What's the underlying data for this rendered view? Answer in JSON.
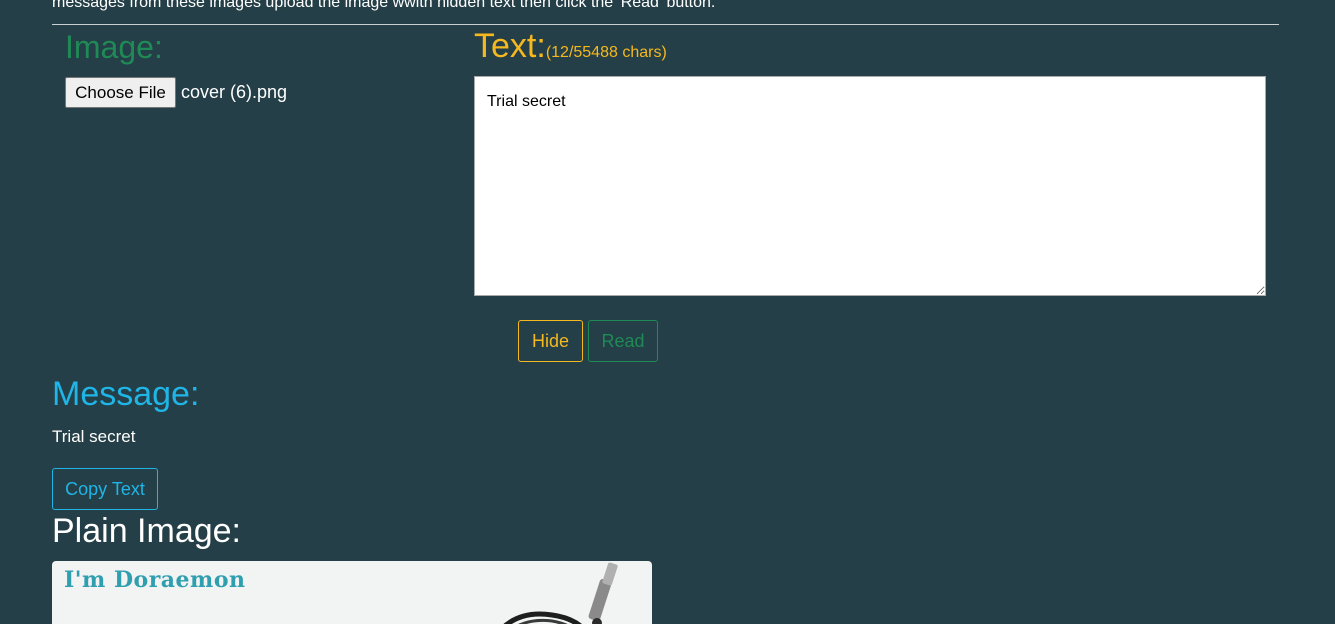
{
  "intro": {
    "text": "messages from these images upload the image wwith hidden text then click the 'Read' button."
  },
  "image_panel": {
    "heading": "Image:",
    "choose_file_label": "Choose File",
    "file_name": "cover (6).png"
  },
  "text_panel": {
    "heading": "Text:",
    "char_count": "(12/55488 chars)",
    "value": "Trial secret"
  },
  "actions": {
    "hide_label": "Hide",
    "read_label": "Read"
  },
  "message": {
    "heading": "Message:",
    "text": "Trial secret",
    "copy_label": "Copy Text"
  },
  "plain_image": {
    "heading": "Plain Image:",
    "logo_text": "I'm Doraemon"
  },
  "colors": {
    "background": "#243f47",
    "image_heading": "#1f8a55",
    "text_heading": "#f5b81e",
    "message_heading": "#1fb5e6"
  }
}
